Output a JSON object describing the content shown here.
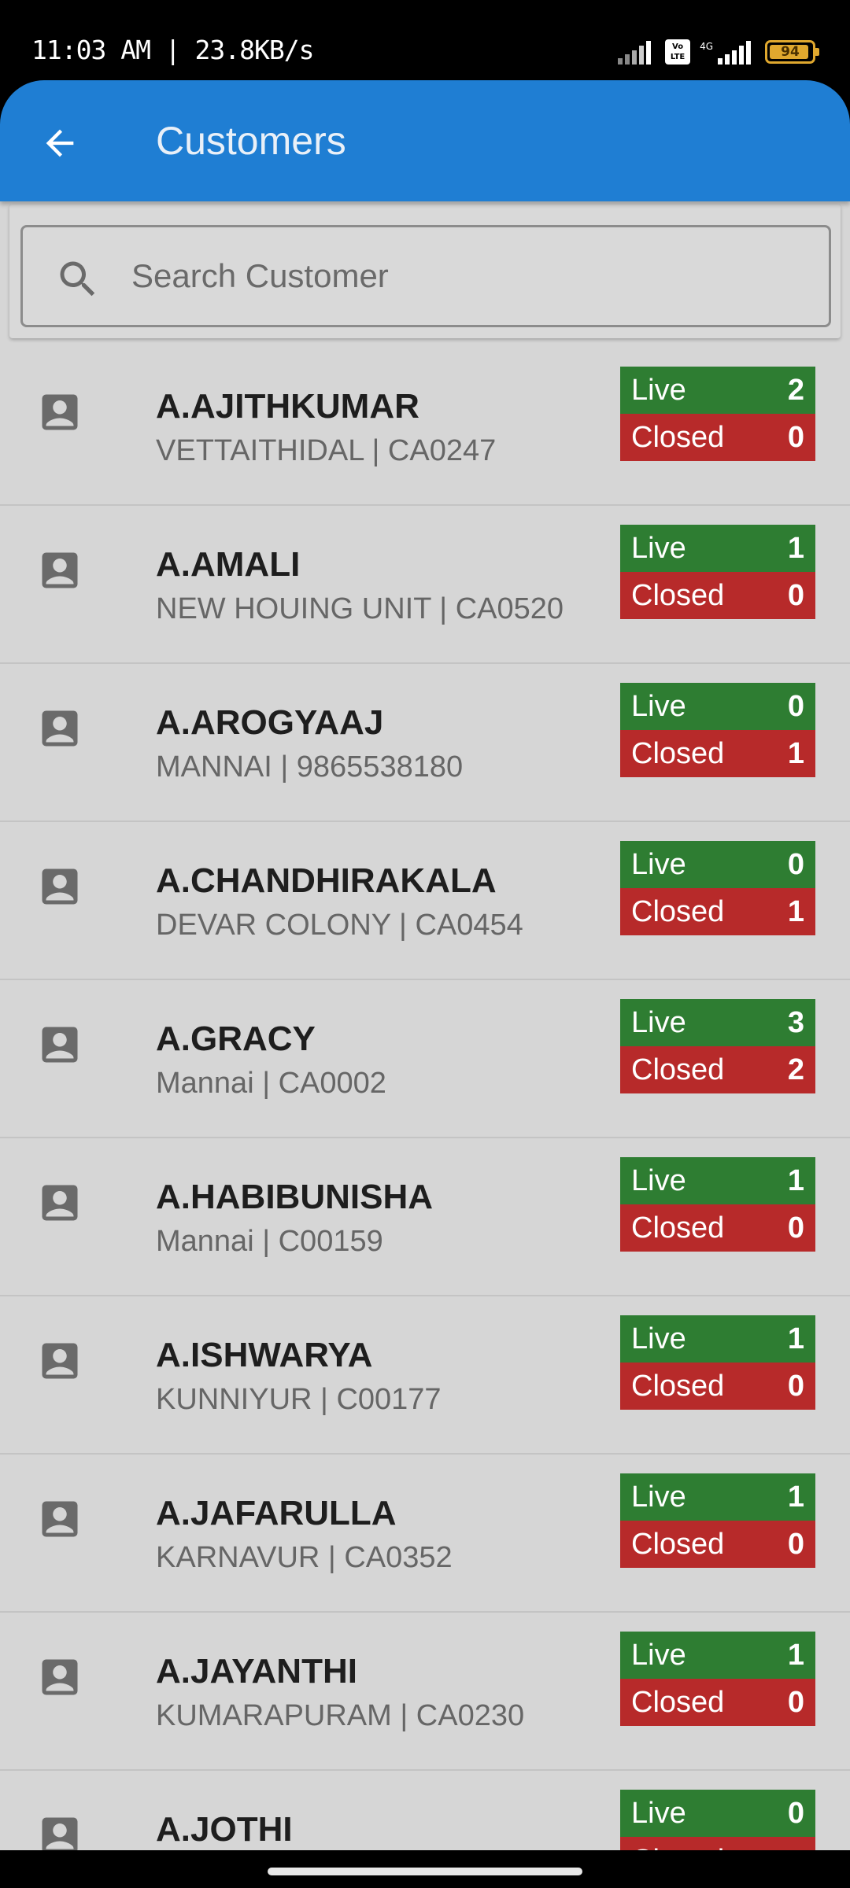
{
  "status_bar": {
    "time": "11:03 AM | 23.8KB/s",
    "battery": "94",
    "volte": {
      "line1": "Vo",
      "line2": "LTE"
    },
    "network": "4G"
  },
  "app_bar": {
    "title": "Customers",
    "color": "#1f7ed3"
  },
  "search": {
    "placeholder": "Search Customer"
  },
  "badge_labels": {
    "live": "Live",
    "closed": "Closed"
  },
  "colors": {
    "live": "#2e7d32",
    "closed": "#b72a2a",
    "list_bg": "#d6d6d6"
  },
  "customers": [
    {
      "name": "A.AJITHKUMAR",
      "subtitle": "VETTAITHIDAL | CA0247",
      "live": "2",
      "closed": "0"
    },
    {
      "name": "A.AMALI",
      "subtitle": "NEW HOUING UNIT | CA0520",
      "live": "1",
      "closed": "0"
    },
    {
      "name": "A.AROGYAAJ",
      "subtitle": "MANNAI | 9865538180",
      "live": "0",
      "closed": "1"
    },
    {
      "name": "A.CHANDHIRAKALA",
      "subtitle": "DEVAR COLONY | CA0454",
      "live": "0",
      "closed": "1"
    },
    {
      "name": "A.GRACY",
      "subtitle": "Mannai | CA0002",
      "live": "3",
      "closed": "2"
    },
    {
      "name": "A.HABIBUNISHA",
      "subtitle": "Mannai | C00159",
      "live": "1",
      "closed": "0"
    },
    {
      "name": "A.ISHWARYA",
      "subtitle": "KUNNIYUR | C00177",
      "live": "1",
      "closed": "0"
    },
    {
      "name": "A.JAFARULLA",
      "subtitle": "KARNAVUR | CA0352",
      "live": "1",
      "closed": "0"
    },
    {
      "name": "A.JAYANTHI",
      "subtitle": "KUMARAPURAM | CA0230",
      "live": "1",
      "closed": "0"
    },
    {
      "name": "A.JOTHI",
      "subtitle": "",
      "live": "0",
      "closed": ""
    }
  ]
}
